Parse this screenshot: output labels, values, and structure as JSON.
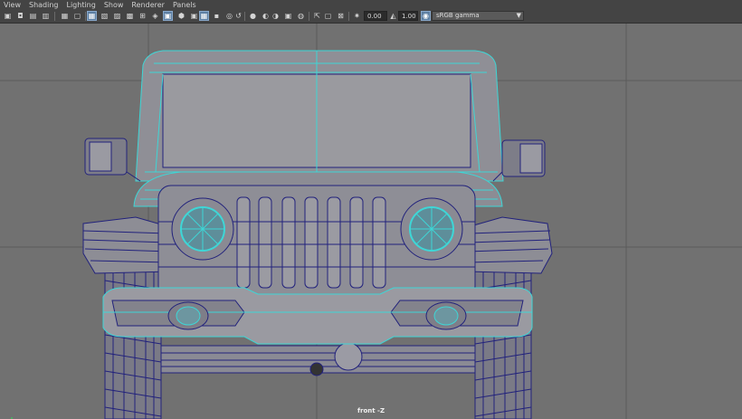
{
  "menu": [
    "View",
    "Shading",
    "Lighting",
    "Show",
    "Renderer",
    "Panels"
  ],
  "toolbar": {
    "gamma_value": "0.00",
    "exposure_value": "1.00",
    "color_space": "sRGB gamma",
    "icons": [
      "camera-select-icon",
      "camera-attributes-icon",
      "bookmark-icon",
      "image-plane-icon",
      "grid-toggle-icon",
      "film-gate-icon",
      "resolution-gate-icon",
      "gate-mask-icon",
      "field-chart-icon",
      "safe-action-icon",
      "safe-title-icon",
      "wireframe-icon",
      "smooth-shade-icon",
      "default-material-icon",
      "textured-icon",
      "use-lights-icon",
      "shadows-icon",
      "ambient-occlusion-icon",
      "motion-blur-icon",
      "antialiasing-icon",
      "depth-of-field-icon",
      "isolate-select-icon",
      "xray-icon",
      "xray-joints-icon",
      "backface-icon",
      "exposure-icon",
      "gamma-icon",
      "color-management-icon"
    ]
  },
  "viewport": {
    "camera_label": "front -Z",
    "background_color": "#717171",
    "grid_color": "#5a5a5a",
    "wire_dark_color": "#1e1e7a",
    "wire_selected_color": "#3ed6d6"
  }
}
